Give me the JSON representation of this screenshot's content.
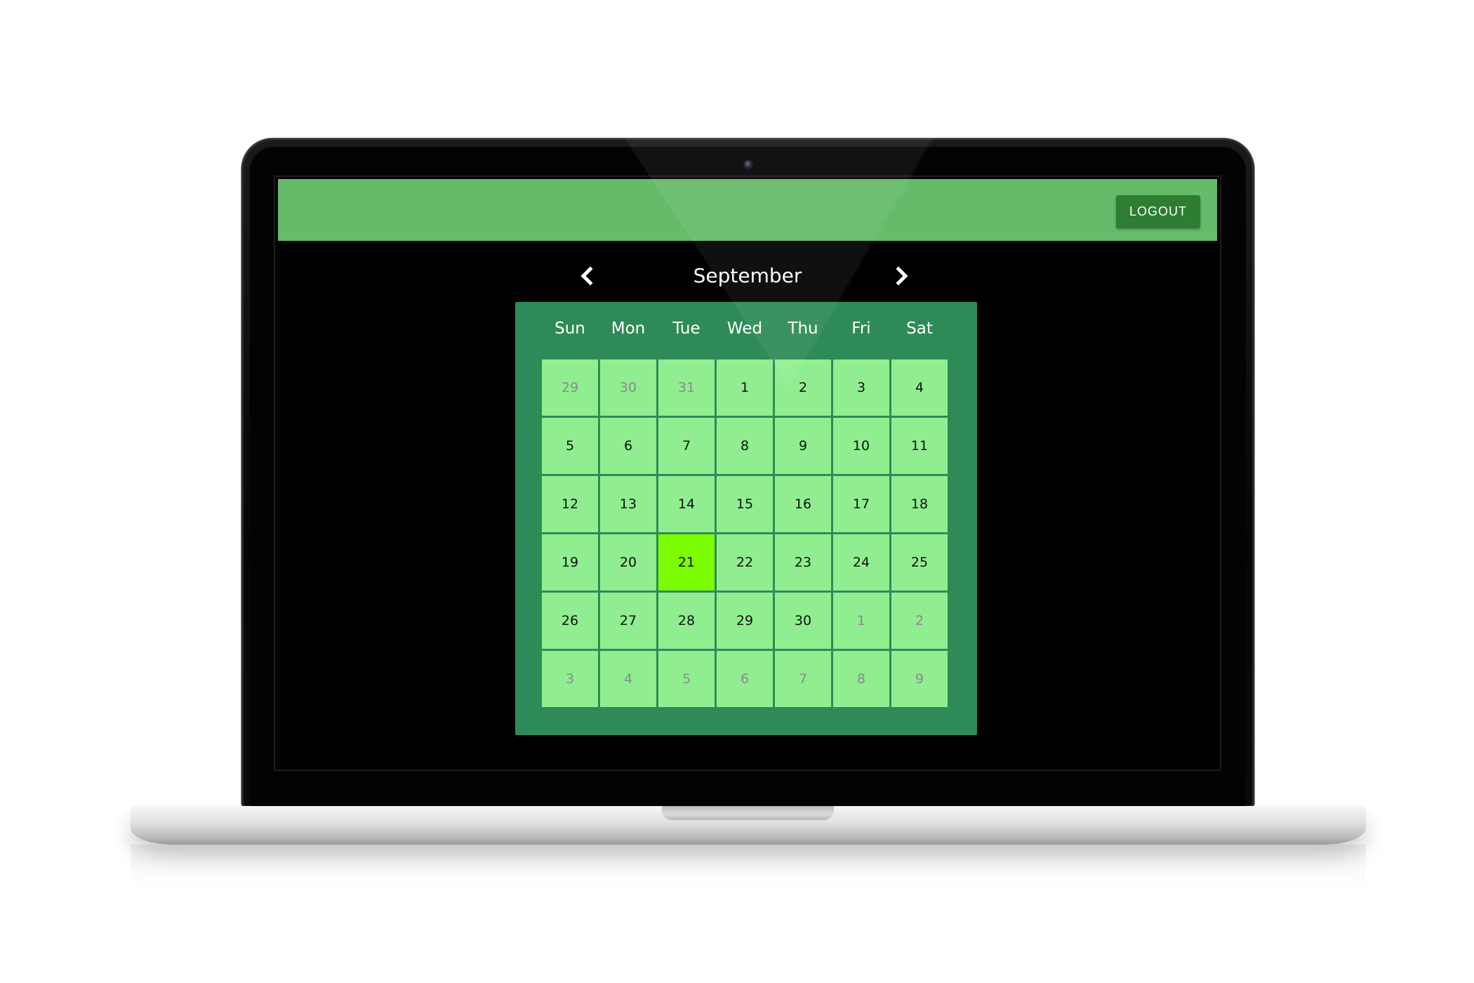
{
  "header": {
    "logout_label": "LOGOUT"
  },
  "calendar": {
    "month": "September",
    "prev_icon": "chevron-left-icon",
    "next_icon": "chevron-right-icon",
    "weekdays": [
      "Sun",
      "Mon",
      "Tue",
      "Wed",
      "Thu",
      "Fri",
      "Sat"
    ],
    "days": [
      {
        "label": "29",
        "muted": true
      },
      {
        "label": "30",
        "muted": true
      },
      {
        "label": "31",
        "muted": true
      },
      {
        "label": "1"
      },
      {
        "label": "2"
      },
      {
        "label": "3"
      },
      {
        "label": "4"
      },
      {
        "label": "5"
      },
      {
        "label": "6"
      },
      {
        "label": "7"
      },
      {
        "label": "8"
      },
      {
        "label": "9"
      },
      {
        "label": "10"
      },
      {
        "label": "11"
      },
      {
        "label": "12"
      },
      {
        "label": "13"
      },
      {
        "label": "14"
      },
      {
        "label": "15"
      },
      {
        "label": "16"
      },
      {
        "label": "17"
      },
      {
        "label": "18"
      },
      {
        "label": "19"
      },
      {
        "label": "20"
      },
      {
        "label": "21",
        "today": true
      },
      {
        "label": "22"
      },
      {
        "label": "23"
      },
      {
        "label": "24"
      },
      {
        "label": "25"
      },
      {
        "label": "26"
      },
      {
        "label": "27"
      },
      {
        "label": "28"
      },
      {
        "label": "29"
      },
      {
        "label": "30"
      },
      {
        "label": "1",
        "muted": true
      },
      {
        "label": "2",
        "muted": true
      },
      {
        "label": "3",
        "muted": true
      },
      {
        "label": "4",
        "muted": true
      },
      {
        "label": "5",
        "muted": true
      },
      {
        "label": "6",
        "muted": true
      },
      {
        "label": "7",
        "muted": true
      },
      {
        "label": "8",
        "muted": true
      },
      {
        "label": "9",
        "muted": true
      }
    ]
  },
  "colors": {
    "topbar": "#66bb6a",
    "logout_button": "#2e7d32",
    "calendar_bg": "#2e8b57",
    "day_cell": "#90ee90",
    "today_cell": "#7cfc00"
  }
}
